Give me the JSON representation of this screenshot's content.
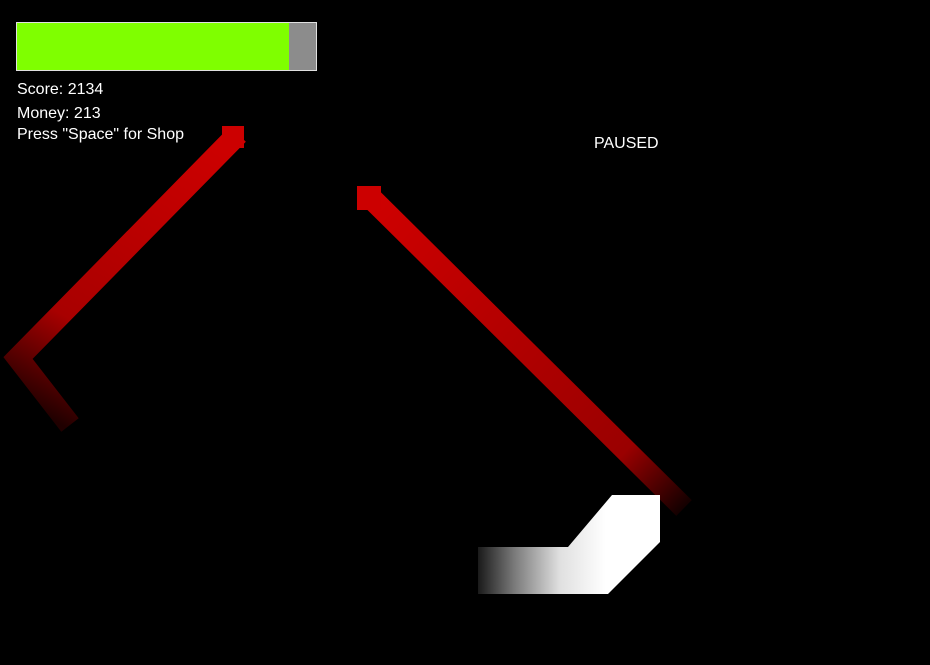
{
  "hud": {
    "health_fraction": 0.91,
    "health_color": "#7fff00",
    "score_text": "Score: 2134",
    "money_text": "Money: 213",
    "shop_hint": "Press \"Space\" for Shop",
    "paused_text": "PAUSED"
  },
  "world": {
    "enemy_color": "#cc0000",
    "player_color": "#ffffff",
    "background": "#000000"
  }
}
